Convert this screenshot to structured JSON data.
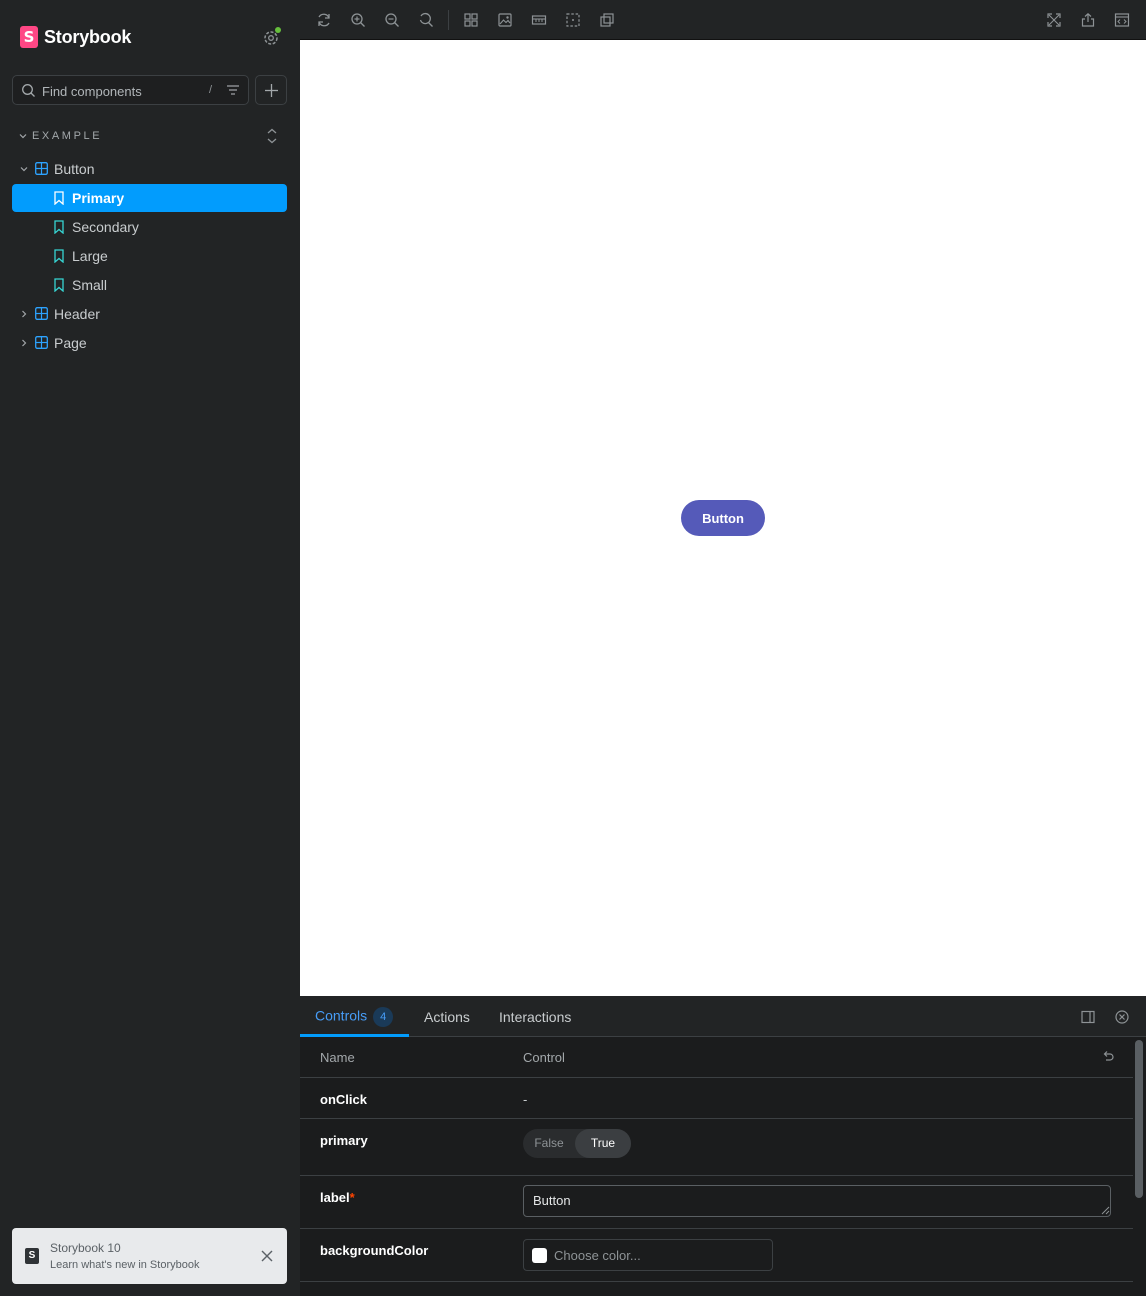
{
  "brand": {
    "name": "Storybook",
    "logo_letter": "S"
  },
  "search": {
    "placeholder": "Find components",
    "shortcut": "/"
  },
  "sidebar": {
    "section": "EXAMPLE",
    "tree": [
      {
        "label": "Button",
        "type": "component",
        "expanded": true
      },
      {
        "label": "Primary",
        "type": "story",
        "selected": true
      },
      {
        "label": "Secondary",
        "type": "story"
      },
      {
        "label": "Large",
        "type": "story"
      },
      {
        "label": "Small",
        "type": "story"
      },
      {
        "label": "Header",
        "type": "component",
        "expanded": false
      },
      {
        "label": "Page",
        "type": "component",
        "expanded": false
      }
    ]
  },
  "notification": {
    "title": "Storybook 10",
    "subtitle": "Learn what's new in Storybook"
  },
  "canvas": {
    "button_label": "Button"
  },
  "panel": {
    "tabs": [
      {
        "label": "Controls",
        "count": "4",
        "active": true
      },
      {
        "label": "Actions"
      },
      {
        "label": "Interactions"
      }
    ],
    "columns": {
      "name": "Name",
      "control": "Control"
    },
    "rows": [
      {
        "name": "onClick",
        "value": "-"
      },
      {
        "name": "primary",
        "false_label": "False",
        "true_label": "True",
        "selected": "True"
      },
      {
        "name": "label",
        "required": "*",
        "value": "Button"
      },
      {
        "name": "backgroundColor",
        "placeholder": "Choose color..."
      }
    ]
  },
  "colors": {
    "accent": "#029cfd",
    "brand": "#ff4785",
    "button": "#555ab9",
    "status_dot": "#66bf3c"
  }
}
